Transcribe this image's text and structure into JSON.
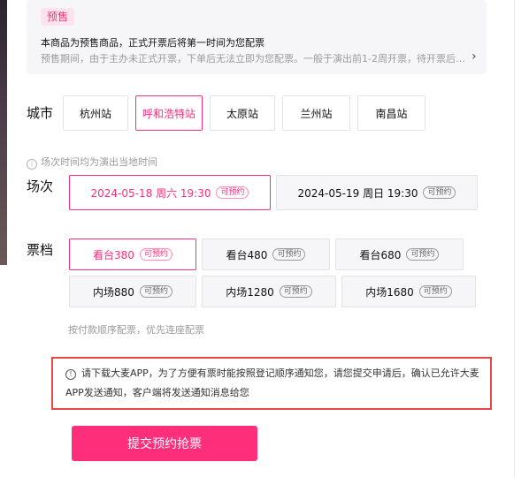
{
  "presale": {
    "tag": "预售",
    "title": "本商品为预售商品，正式开票后将第一时间为您配票",
    "desc": "预售期间，由于主办未正式开票，下单后无法立即为您配票。一般于演出前1-2周开票，待开票后方可配票。"
  },
  "city": {
    "label": "城市",
    "options": [
      "杭州站",
      "呼和浩特站",
      "太原站",
      "兰州站",
      "南昌站"
    ],
    "selected_index": 1
  },
  "session": {
    "note": "场次时间均为演出当地时间",
    "label": "场次",
    "options": [
      {
        "text": "2024-05-18 周六 19:30",
        "badge": "可预约"
      },
      {
        "text": "2024-05-19 周日 19:30",
        "badge": "可预约"
      }
    ],
    "selected_index": 0
  },
  "tier": {
    "label": "票档",
    "options": [
      {
        "text": "看台380",
        "badge": "可预约"
      },
      {
        "text": "看台480",
        "badge": "可预约"
      },
      {
        "text": "看台680",
        "badge": "可预约"
      },
      {
        "text": "内场880",
        "badge": "可预约"
      },
      {
        "text": "内场1280",
        "badge": "可预约"
      },
      {
        "text": "内场1680",
        "badge": "可预约"
      }
    ],
    "selected_index": 0,
    "note": "按付款顺序配票，优先连座配票"
  },
  "notice": {
    "text": "请下载大麦APP，为了方便有票时能按照登记顺序通知您，请您提交申请后，确认已允许大麦APP发送通知，客户端将发送通知消息给您"
  },
  "submit_label": "提交预约抢票",
  "colors": {
    "accent": "#ff2e7a",
    "notice_border": "#e64848"
  }
}
